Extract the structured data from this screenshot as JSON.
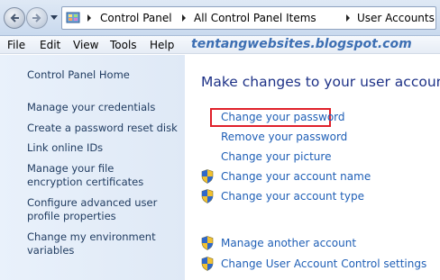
{
  "breadcrumb": {
    "items": [
      "Control Panel",
      "All Control Panel Items",
      "User Accounts"
    ]
  },
  "menubar": {
    "items": [
      "File",
      "Edit",
      "View",
      "Tools",
      "Help"
    ],
    "watermark": "tentangwebsites.blogspot.com"
  },
  "sidebar": {
    "home": "Control Panel Home",
    "links": [
      "Manage your credentials",
      "Create a password reset disk",
      "Link online IDs",
      "Manage your file encryption certificates",
      "Configure advanced user profile properties",
      "Change my environment variables"
    ]
  },
  "main": {
    "heading": "Make changes to your user account",
    "tasks": [
      {
        "label": "Change your password",
        "icon": "none"
      },
      {
        "label": "Remove your password",
        "icon": "none"
      },
      {
        "label": "Change your picture",
        "icon": "none"
      },
      {
        "label": "Change your account name",
        "icon": "uac-shield-icon"
      },
      {
        "label": "Change your account type",
        "icon": "uac-shield-icon"
      }
    ],
    "other_tasks": [
      {
        "label": "Manage another account",
        "icon": "uac-shield-icon"
      },
      {
        "label": "Change User Account Control settings",
        "icon": "uac-shield-icon"
      }
    ],
    "highlight_color": "#e0202a",
    "link_color": "#1f5fb6"
  }
}
